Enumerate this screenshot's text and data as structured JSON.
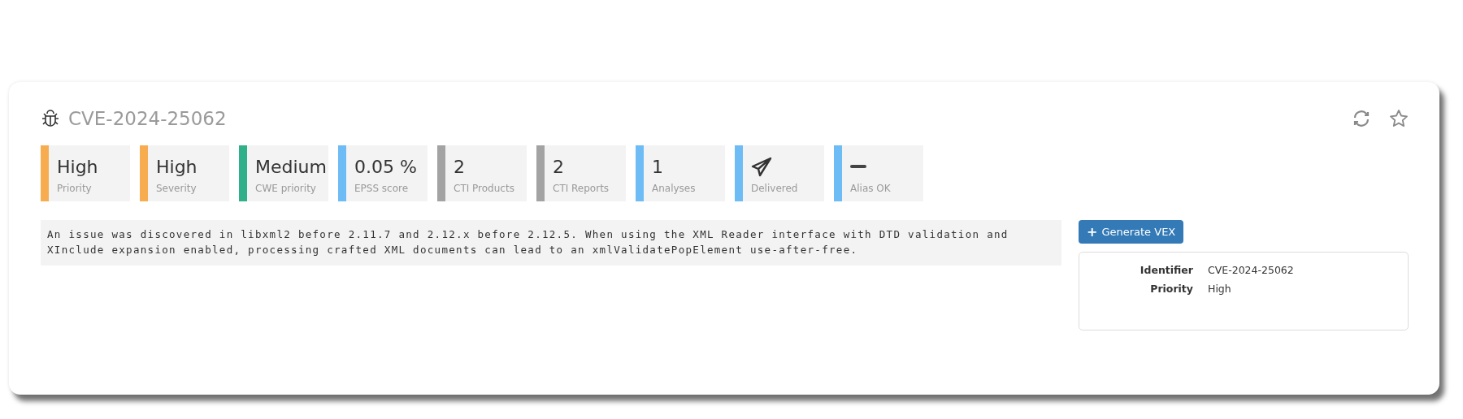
{
  "title": "CVE-2024-25062",
  "tiles": [
    {
      "kind": "text",
      "value": "High",
      "label": "Priority",
      "color": "#f7ad4f"
    },
    {
      "kind": "text",
      "value": "High",
      "label": "Severity",
      "color": "#f7ad4f"
    },
    {
      "kind": "text",
      "value": "Medium",
      "label": "CWE priority",
      "color": "#2fb088"
    },
    {
      "kind": "text",
      "value": "0.05 %",
      "label": "EPSS score",
      "color": "#6dbcf5"
    },
    {
      "kind": "text",
      "value": "2",
      "label": "CTI Products",
      "color": "#a3a3a3"
    },
    {
      "kind": "text",
      "value": "2",
      "label": "CTI Reports",
      "color": "#a3a3a3"
    },
    {
      "kind": "text",
      "value": "1",
      "label": "Analyses",
      "color": "#6dbcf5"
    },
    {
      "kind": "plane",
      "label": "Delivered",
      "color": "#6dbcf5"
    },
    {
      "kind": "minus",
      "label": "Alias OK",
      "color": "#6dbcf5"
    }
  ],
  "description": "An issue was discovered in libxml2 before 2.11.7 and 2.12.x before 2.12.5. When using the XML Reader interface with DTD validation and XInclude expansion enabled, processing crafted XML documents can lead to an xmlValidatePopElement use-after-free.",
  "generate_button": {
    "icon": "+",
    "label": "Generate VEX"
  },
  "details": [
    {
      "label": "Identifier",
      "value": "CVE-2024-25062"
    },
    {
      "label": "Priority",
      "value": "High"
    }
  ]
}
